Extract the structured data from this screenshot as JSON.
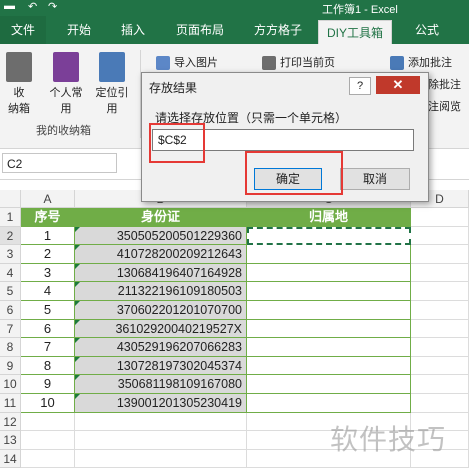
{
  "window": {
    "title": "工作簿1 - Excel"
  },
  "tabs": [
    {
      "label": "文件",
      "active": false
    },
    {
      "label": "开始",
      "active": false
    },
    {
      "label": "插入",
      "active": false
    },
    {
      "label": "页面布局",
      "active": false
    },
    {
      "label": "方方格子",
      "active": false
    },
    {
      "label": "DIY工具箱",
      "active": true
    },
    {
      "label": "公式",
      "active": false
    }
  ],
  "ribbon": {
    "btn_collect": "收\n纳箱",
    "btn_personal": "个人常\n用",
    "btn_locate": "定位引\n用",
    "group_label": "我的收纳箱",
    "btn_import_image": "导入图片",
    "btn_print_page": "打印当前页",
    "btn_add_note": "添加批注",
    "btn_delete_note": "除批注",
    "btn_read_note": "注阅览"
  },
  "formula_bar": {
    "name_box": "C2"
  },
  "grid": {
    "col_headers": [
      "A",
      "B",
      "C",
      "D"
    ],
    "row_numbers": [
      "1",
      "2",
      "3",
      "4",
      "5",
      "6",
      "7",
      "8",
      "9",
      "10",
      "11",
      "12",
      "13",
      "14"
    ],
    "headers": [
      "序号",
      "身份证",
      "归属地"
    ],
    "rows": [
      {
        "seq": "1",
        "id": "350505200501229360"
      },
      {
        "seq": "2",
        "id": "410728200209212643"
      },
      {
        "seq": "3",
        "id": "130684196407164928"
      },
      {
        "seq": "4",
        "id": "211322196109180503"
      },
      {
        "seq": "5",
        "id": "370602201201070700"
      },
      {
        "seq": "6",
        "id": "36102920040219527X"
      },
      {
        "seq": "7",
        "id": "430529196207066283"
      },
      {
        "seq": "8",
        "id": "130728197302045374"
      },
      {
        "seq": "9",
        "id": "350681198109167080"
      },
      {
        "seq": "10",
        "id": "139001201305230419"
      }
    ]
  },
  "dialog": {
    "title": "存放结果",
    "help": "?",
    "close": "✕",
    "prompt": "请选择存放位置（只需一个单元格）",
    "value": "$C$2",
    "ok_label": "确定",
    "cancel_label": "取消"
  },
  "watermark": "软件技巧",
  "colors": {
    "excel_green": "#217346",
    "header_green": "#70ad47",
    "highlight_red": "#e53935"
  }
}
